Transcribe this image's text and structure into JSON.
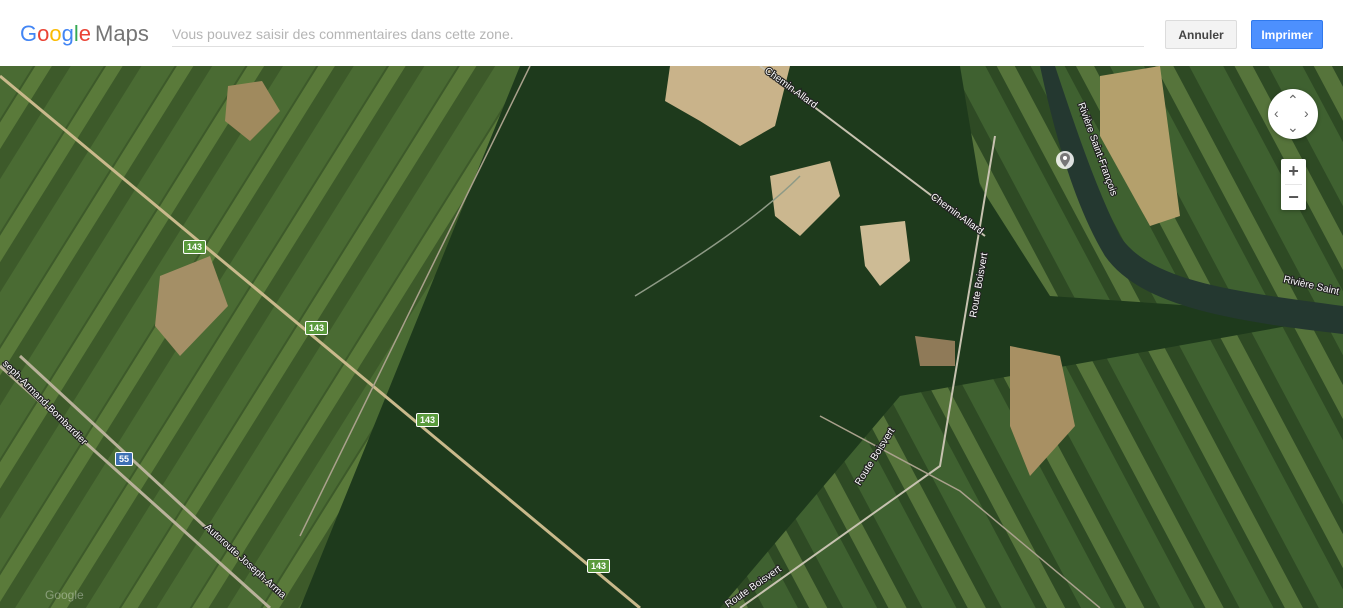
{
  "header": {
    "logo_google": "Google",
    "logo_maps": "Maps",
    "comment_placeholder": "Vous pouvez saisir des commentaires dans cette zone.",
    "comment_value": "",
    "cancel_label": "Annuler",
    "print_label": "Imprimer"
  },
  "map": {
    "view": "satellite",
    "road_labels": {
      "chemin_allard_1": "Chemin Allard",
      "chemin_allard_2": "Chemin Allard",
      "route_boisvert_1": "Route Boisvert",
      "route_boisvert_2": "Route Boisvert",
      "route_boisvert_3": "Route Boisvert",
      "riviere_1": "Rivière Saint-François",
      "riviere_2": "Rivière Saint",
      "autoroute_1": "seph-Armand-Bombardier",
      "autoroute_2": "Autoroute Joseph-Arma"
    },
    "shields": {
      "r143_a": "143",
      "r143_b": "143",
      "r143_c": "143",
      "r143_d": "143",
      "a55": "55"
    },
    "zoom_in": "+",
    "zoom_out": "−",
    "watermark": "Google"
  },
  "colors": {
    "print_button": "#4d90fe",
    "google_blue": "#4285f4",
    "google_red": "#ea4335",
    "google_yellow": "#fbbc05",
    "google_green": "#34a853"
  }
}
